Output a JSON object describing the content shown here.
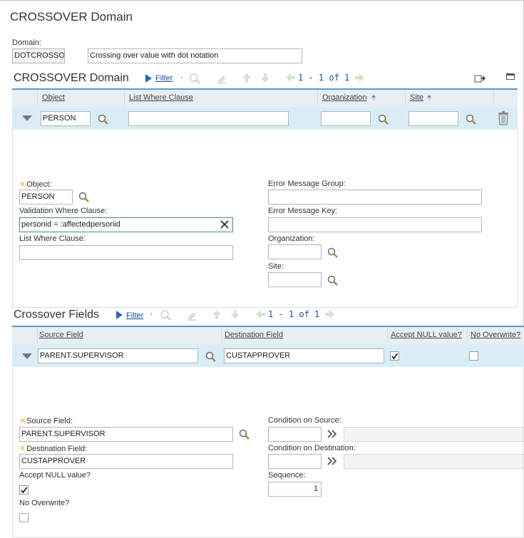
{
  "window": {
    "title": "CROSSOVER Domain"
  },
  "domain": {
    "label": "Domain:",
    "id_value": "DOTCROSSO",
    "description_value": "Crossing over value with dot notation"
  },
  "crossover_section": {
    "title": "CROSSOVER Domain",
    "filter_label": "Filter",
    "pagination": "1 - 1 of 1",
    "columns": [
      "Object",
      "List Where Clause",
      "Organization",
      "Site"
    ],
    "row": {
      "object": "PERSON",
      "list_where": "",
      "organization": "",
      "site": ""
    },
    "detail": {
      "object_label": "Object:",
      "object_value": "PERSON",
      "validation_label": "Validation Where Clause:",
      "validation_value": "personid = :affectedpersonid",
      "list_where_label": "List Where Clause:",
      "list_where_value": "",
      "error_group_label": "Error Message Group:",
      "error_group_value": "",
      "error_key_label": "Error Message Key:",
      "error_key_value": "",
      "org_label": "Organization:",
      "org_value": "",
      "site_label": "Site:",
      "site_value": ""
    }
  },
  "fields_section": {
    "title": "Crossover Fields",
    "filter_label": "Filter",
    "pagination": "1 - 1 of 1",
    "columns": [
      "Source Field",
      "Destination Field",
      "Accept NULL value?",
      "No Overwrite?"
    ],
    "row": {
      "source": "PARENT.SUPERVISOR",
      "destination": "CUSTAPPROVER",
      "accept_null": true,
      "no_overwrite": false
    },
    "detail": {
      "source_label": "Source Field:",
      "source_value": "PARENT.SUPERVISOR",
      "dest_label": "Destination Field:",
      "dest_value": "CUSTAPPROVER",
      "accept_null_label": "Accept NULL value?",
      "no_overwrite_label": "No Overwrite?",
      "cond_source_label": "Condition on Source:",
      "cond_dest_label": "Condition on Destination:",
      "sequence_label": "Sequence:",
      "sequence_value": "1"
    }
  }
}
